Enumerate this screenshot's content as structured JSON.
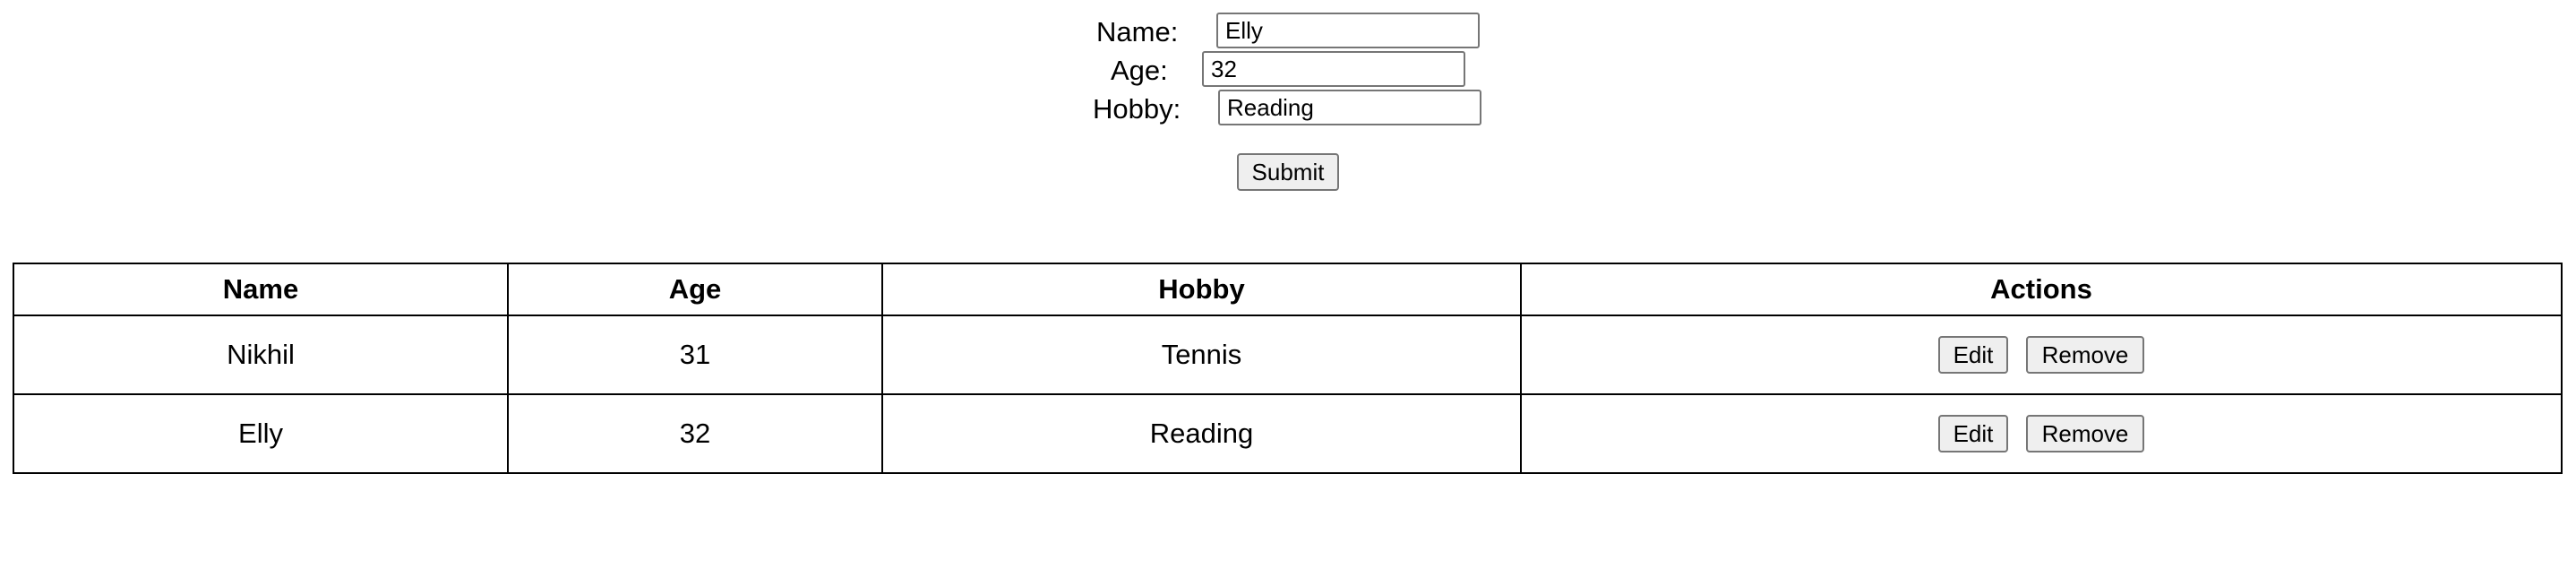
{
  "form": {
    "name_label": "Name:",
    "name_value": "Elly",
    "age_label": "Age:",
    "age_value": "32",
    "hobby_label": "Hobby:",
    "hobby_value": "Reading",
    "submit_label": "Submit"
  },
  "table": {
    "headers": {
      "name": "Name",
      "age": "Age",
      "hobby": "Hobby",
      "actions": "Actions"
    },
    "rows": [
      {
        "name": "Nikhil",
        "age": "31",
        "hobby": "Tennis",
        "edit_label": "Edit",
        "remove_label": "Remove"
      },
      {
        "name": "Elly",
        "age": "32",
        "hobby": "Reading",
        "edit_label": "Edit",
        "remove_label": "Remove"
      }
    ]
  }
}
